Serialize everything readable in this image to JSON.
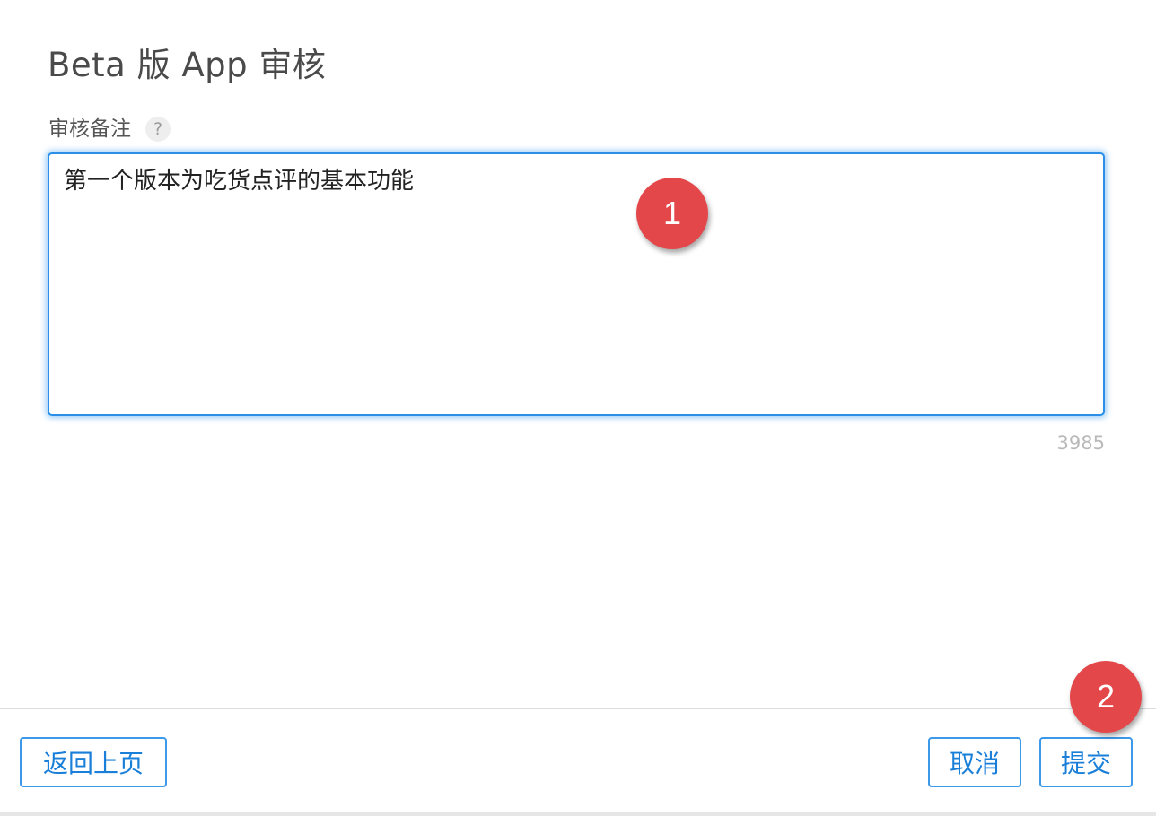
{
  "dialog": {
    "title": "Beta 版 App 审核"
  },
  "review_notes": {
    "label": "审核备注",
    "help_glyph": "?",
    "value": "第一个版本为吃货点评的基本功能",
    "remaining_chars": "3985"
  },
  "annotations": {
    "badge_1": "1",
    "badge_2": "2",
    "badge_color": "#e4474a"
  },
  "footer": {
    "back_label": "返回上页",
    "cancel_label": "取消",
    "submit_label": "提交"
  },
  "colors": {
    "accent": "#1a7fd8",
    "focus_border": "#2b8fe8"
  }
}
